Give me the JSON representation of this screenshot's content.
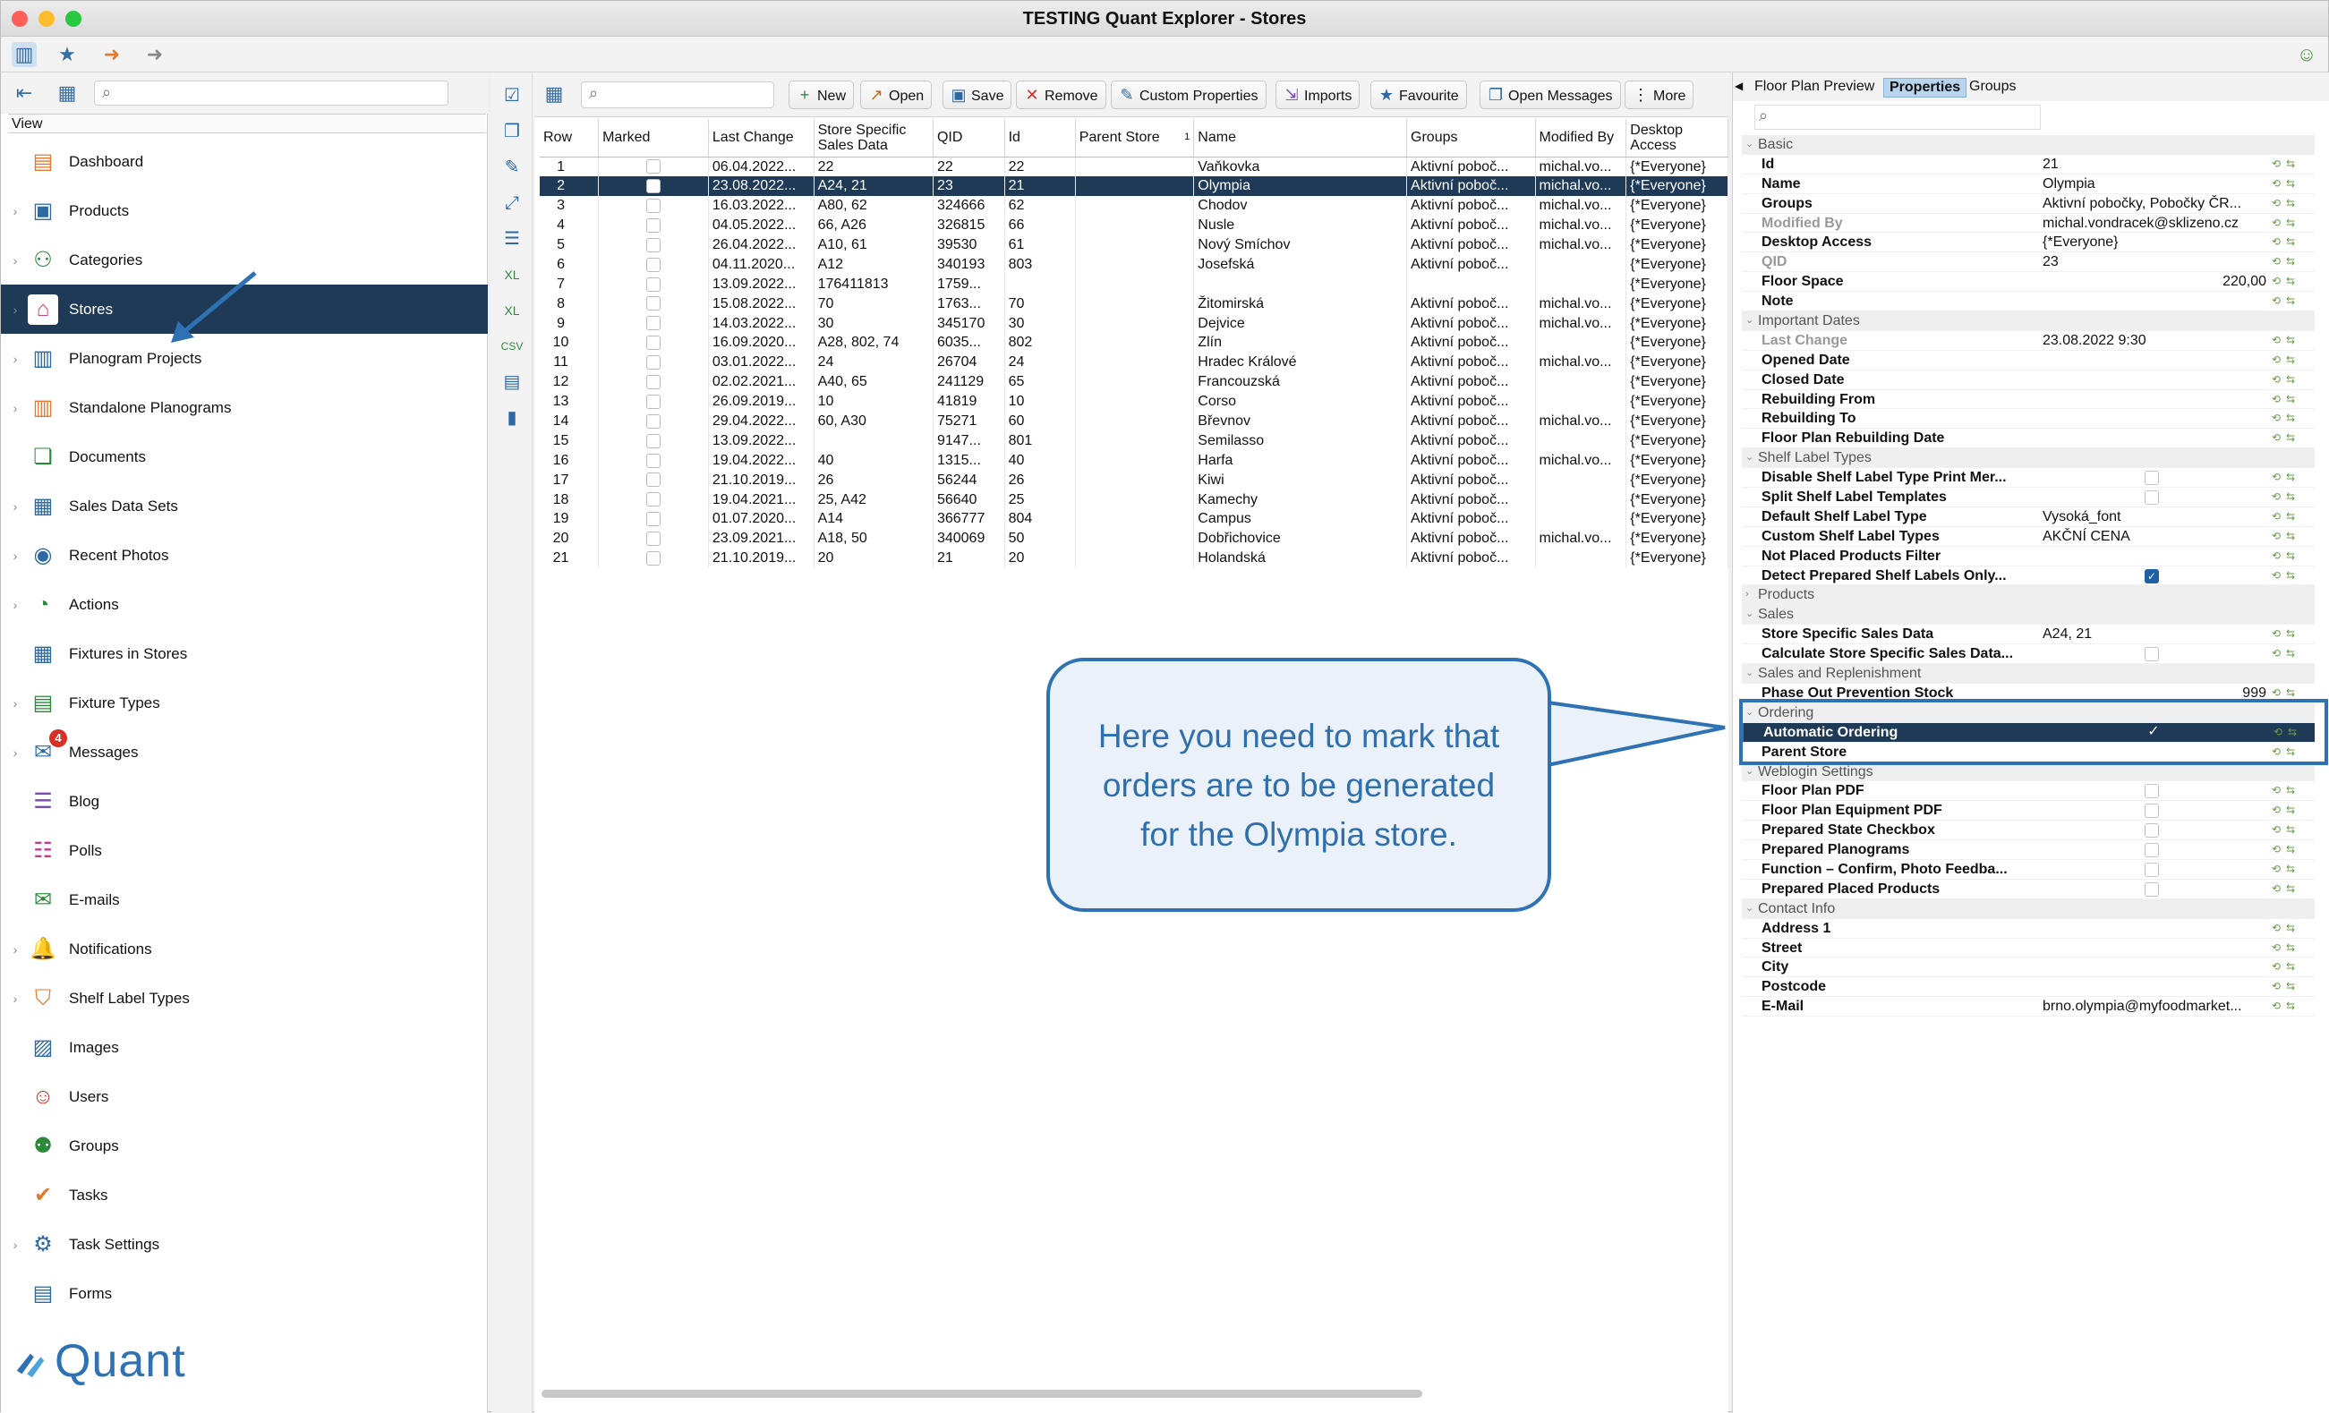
{
  "window": {
    "title": "TESTING Quant Explorer - Stores"
  },
  "left_panel": {
    "view_label": "View",
    "search_placeholder": "",
    "items": [
      {
        "label": "Dashboard",
        "icon": "dashboard-icon",
        "chev": false
      },
      {
        "label": "Products",
        "icon": "products-icon",
        "chev": true
      },
      {
        "label": "Categories",
        "icon": "categories-icon",
        "chev": true
      },
      {
        "label": "Stores",
        "icon": "stores-icon",
        "chev": true,
        "selected": true
      },
      {
        "label": "Planogram Projects",
        "icon": "planogram-projects-icon",
        "chev": true
      },
      {
        "label": "Standalone Planograms",
        "icon": "standalone-planograms-icon",
        "chev": true
      },
      {
        "label": "Documents",
        "icon": "documents-icon",
        "chev": false
      },
      {
        "label": "Sales Data Sets",
        "icon": "sales-data-sets-icon",
        "chev": true
      },
      {
        "label": "Recent Photos",
        "icon": "recent-photos-icon",
        "chev": true
      },
      {
        "label": "Actions",
        "icon": "actions-icon",
        "chev": true
      },
      {
        "label": "Fixtures in Stores",
        "icon": "fixtures-in-stores-icon",
        "chev": false
      },
      {
        "label": "Fixture Types",
        "icon": "fixture-types-icon",
        "chev": true
      },
      {
        "label": "Messages",
        "icon": "messages-icon",
        "chev": true,
        "badge": "4"
      },
      {
        "label": "Blog",
        "icon": "blog-icon",
        "chev": false
      },
      {
        "label": "Polls",
        "icon": "polls-icon",
        "chev": false
      },
      {
        "label": "E-mails",
        "icon": "emails-icon",
        "chev": false
      },
      {
        "label": "Notifications",
        "icon": "notifications-icon",
        "chev": true
      },
      {
        "label": "Shelf Label Types",
        "icon": "shelf-label-types-icon",
        "chev": true
      },
      {
        "label": "Images",
        "icon": "images-icon",
        "chev": false
      },
      {
        "label": "Users",
        "icon": "users-icon",
        "chev": false
      },
      {
        "label": "Groups",
        "icon": "groups-icon",
        "chev": false
      },
      {
        "label": "Tasks",
        "icon": "tasks-icon",
        "chev": false
      },
      {
        "label": "Task Settings",
        "icon": "task-settings-icon",
        "chev": true
      },
      {
        "label": "Forms",
        "icon": "forms-icon",
        "chev": false
      }
    ],
    "logo_text": "Quant"
  },
  "toolbar": {
    "new": "New",
    "open": "Open",
    "save": "Save",
    "remove": "Remove",
    "custom_properties": "Custom Properties",
    "imports": "Imports",
    "favourite": "Favourite",
    "open_messages": "Open Messages",
    "more": "More"
  },
  "table": {
    "headers": [
      "Row",
      "Marked",
      "Last Change",
      "Store Specific Sales Data",
      "QID",
      "Id",
      "Parent Store",
      "Name",
      "Groups",
      "Modified By",
      "Desktop Access"
    ],
    "sort_indicator": "1",
    "rows": [
      [
        "1",
        "",
        "06.04.2022...",
        "22",
        "22",
        "22",
        "",
        "Vaňkovka",
        "Aktivní poboč...",
        "michal.vo...",
        "{*Everyone}"
      ],
      [
        "2",
        "",
        "23.08.2022...",
        "A24, 21",
        "23",
        "21",
        "",
        "Olympia",
        "Aktivní poboč...",
        "michal.vo...",
        "{*Everyone}"
      ],
      [
        "3",
        "",
        "16.03.2022...",
        "A80, 62",
        "324666",
        "62",
        "",
        "Chodov",
        "Aktivní poboč...",
        "michal.vo...",
        "{*Everyone}"
      ],
      [
        "4",
        "",
        "04.05.2022...",
        "66, A26",
        "326815",
        "66",
        "",
        "Nusle",
        "Aktivní poboč...",
        "michal.vo...",
        "{*Everyone}"
      ],
      [
        "5",
        "",
        "26.04.2022...",
        "A10, 61",
        "39530",
        "61",
        "",
        "Nový Smíchov",
        "Aktivní poboč...",
        "michal.vo...",
        "{*Everyone}"
      ],
      [
        "6",
        "",
        "04.11.2020...",
        "A12",
        "340193",
        "803",
        "",
        "Josefská",
        "Aktivní poboč...",
        "",
        "{*Everyone}"
      ],
      [
        "7",
        "",
        "13.09.2022...",
        "176411813",
        "1759...",
        "",
        "",
        "",
        "",
        "",
        "{*Everyone}"
      ],
      [
        "8",
        "",
        "15.08.2022...",
        "70",
        "1763...",
        "70",
        "",
        "Žitomirská",
        "Aktivní poboč...",
        "michal.vo...",
        "{*Everyone}"
      ],
      [
        "9",
        "",
        "14.03.2022...",
        "30",
        "345170",
        "30",
        "",
        "Dejvice",
        "Aktivní poboč...",
        "michal.vo...",
        "{*Everyone}"
      ],
      [
        "10",
        "",
        "16.09.2020...",
        "A28, 802, 74",
        "6035...",
        "802",
        "",
        "Zlín",
        "Aktivní poboč...",
        "",
        "{*Everyone}"
      ],
      [
        "11",
        "",
        "03.01.2022...",
        "24",
        "26704",
        "24",
        "",
        "Hradec Králové",
        "Aktivní poboč...",
        "michal.vo...",
        "{*Everyone}"
      ],
      [
        "12",
        "",
        "02.02.2021...",
        "A40, 65",
        "241129",
        "65",
        "",
        "Francouzská",
        "Aktivní poboč...",
        "",
        "{*Everyone}"
      ],
      [
        "13",
        "",
        "26.09.2019...",
        "10",
        "41819",
        "10",
        "",
        "Corso",
        "Aktivní poboč...",
        "",
        "{*Everyone}"
      ],
      [
        "14",
        "",
        "29.04.2022...",
        "60, A30",
        "75271",
        "60",
        "",
        "Břevnov",
        "Aktivní poboč...",
        "michal.vo...",
        "{*Everyone}"
      ],
      [
        "15",
        "",
        "13.09.2022...",
        "",
        "9147...",
        "801",
        "",
        "Semilasso",
        "Aktivní poboč...",
        "",
        "{*Everyone}"
      ],
      [
        "16",
        "",
        "19.04.2022...",
        "40",
        "1315...",
        "40",
        "",
        "Harfa",
        "Aktivní poboč...",
        "michal.vo...",
        "{*Everyone}"
      ],
      [
        "17",
        "",
        "21.10.2019...",
        "26",
        "56244",
        "26",
        "",
        "Kiwi",
        "Aktivní poboč...",
        "",
        "{*Everyone}"
      ],
      [
        "18",
        "",
        "19.04.2021...",
        "25, A42",
        "56640",
        "25",
        "",
        "Kamechy",
        "Aktivní poboč...",
        "",
        "{*Everyone}"
      ],
      [
        "19",
        "",
        "01.07.2020...",
        "A14",
        "366777",
        "804",
        "",
        "Campus",
        "Aktivní poboč...",
        "",
        "{*Everyone}"
      ],
      [
        "20",
        "",
        "23.09.2021...",
        "A18, 50",
        "340069",
        "50",
        "",
        "Dobřichovice",
        "Aktivní poboč...",
        "michal.vo...",
        "{*Everyone}"
      ],
      [
        "21",
        "",
        "21.10.2019...",
        "20",
        "21",
        "20",
        "",
        "Holandská",
        "Aktivní poboč...",
        "",
        "{*Everyone}"
      ]
    ],
    "selected_row": 1
  },
  "right_panel": {
    "tabs": [
      "Floor Plan Preview",
      "Properties",
      "Groups"
    ],
    "active_tab": 1,
    "properties": [
      {
        "g": true,
        "k": "Basic"
      },
      {
        "k": "Id",
        "v": "21"
      },
      {
        "k": "Name",
        "v": "Olympia"
      },
      {
        "k": "Groups",
        "v": "Aktivní pobočky, Pobočky ČR..."
      },
      {
        "k": "Modified By",
        "v": "michal.vondracek@sklizeno.cz",
        "dim": true
      },
      {
        "k": "Desktop Access",
        "v": "{*Everyone}"
      },
      {
        "k": "QID",
        "v": "23",
        "dim": true
      },
      {
        "k": "Floor Space",
        "v": "220,00",
        "right": true
      },
      {
        "k": "Note",
        "v": ""
      },
      {
        "g": true,
        "k": "Important Dates"
      },
      {
        "k": "Last Change",
        "v": "23.08.2022 9:30",
        "dim": true
      },
      {
        "k": "Opened Date",
        "v": ""
      },
      {
        "k": "Closed Date",
        "v": ""
      },
      {
        "k": "Rebuilding From",
        "v": ""
      },
      {
        "k": "Rebuilding To",
        "v": ""
      },
      {
        "k": "Floor Plan Rebuilding Date",
        "v": ""
      },
      {
        "g": true,
        "k": "Shelf Label Types"
      },
      {
        "k": "Disable Shelf Label Type Print Mer...",
        "cb": "off"
      },
      {
        "k": "Split Shelf Label Templates",
        "cb": "off"
      },
      {
        "k": "Default Shelf Label Type",
        "v": "Vysoká_font"
      },
      {
        "k": "Custom Shelf Label Types",
        "v": "AKČNÍ CENA"
      },
      {
        "k": "Not Placed Products Filter",
        "v": ""
      },
      {
        "k": "Detect Prepared Shelf Labels Only...",
        "cb": "on"
      },
      {
        "g": true,
        "k": "Products",
        "collapsed": true
      },
      {
        "g": true,
        "k": "Sales"
      },
      {
        "k": "Store Specific Sales Data",
        "v": "A24, 21"
      },
      {
        "k": "Calculate Store Specific Sales Data...",
        "cb": "off"
      },
      {
        "g": true,
        "k": "Sales and Replenishment"
      },
      {
        "k": "Phase Out Prevention Stock",
        "v": "999",
        "right": true
      },
      {
        "g": true,
        "k": "Ordering"
      },
      {
        "k": "Automatic Ordering",
        "cb": "on",
        "sel": true
      },
      {
        "k": "Parent Store",
        "v": ""
      },
      {
        "g": true,
        "k": "Weblogin Settings"
      },
      {
        "k": "Floor Plan PDF",
        "cb": "off"
      },
      {
        "k": "Floor Plan Equipment PDF",
        "cb": "off"
      },
      {
        "k": "Prepared State Checkbox",
        "cb": "off"
      },
      {
        "k": "Prepared Planograms",
        "cb": "off"
      },
      {
        "k": "Function – Confirm, Photo Feedba...",
        "cb": "off"
      },
      {
        "k": "Prepared Placed Products",
        "cb": "off"
      },
      {
        "g": true,
        "k": "Contact Info"
      },
      {
        "k": "Address 1",
        "v": ""
      },
      {
        "k": "Street",
        "v": ""
      },
      {
        "k": "City",
        "v": ""
      },
      {
        "k": "Postcode",
        "v": ""
      },
      {
        "k": "E-Mail",
        "v": "brno.olympia@myfoodmarket..."
      }
    ]
  },
  "callout": {
    "text": "Here you need to mark that orders are to be generated for the Olympia store."
  },
  "colors": {
    "selection": "#1e3a57",
    "accent": "#2f72b3",
    "callout_bg": "#eaf1f8"
  }
}
